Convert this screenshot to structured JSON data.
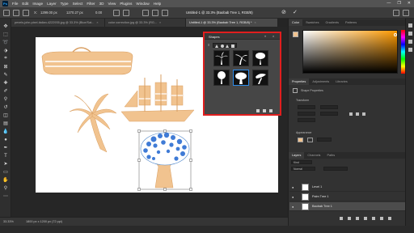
{
  "menubar": {
    "app_icon": "Ps",
    "items": [
      "File",
      "Edit",
      "Image",
      "Layer",
      "Type",
      "Select",
      "Filter",
      "3D",
      "View",
      "Plugins",
      "Window",
      "Help"
    ],
    "window_controls": [
      "—",
      "❐",
      "✕"
    ]
  },
  "options": {
    "w_value": "1299.00 px",
    "h_value": "1270.27 px",
    "angle_value": "0.00",
    "doc_status": "Untitled-1 @ 33.3% (Baobab Tree 1, RGB/8)",
    "cancel_icon": "⊘",
    "commit_icon": "✓"
  },
  "tabs": [
    {
      "label": "pexels-john-pixel-italian-4222935.jpg @ 33.3% (Blue/Sat...",
      "close": "×"
    },
    {
      "label": "color correction.jpg @ 33.3% (RG...",
      "close": "×"
    },
    {
      "label": "Untitled-1 @ 33.3% (Baobab Tree 1, RGB/8) *",
      "close": "×"
    }
  ],
  "shapes_panel": {
    "title": "Shapes",
    "collapse": "«",
    "close": "×",
    "menu": "≡"
  },
  "right_panels": {
    "color_tabs": [
      "Color",
      "Swatches",
      "Gradients",
      "Patterns"
    ],
    "props_tabs": [
      "Properties",
      "Adjustments",
      "Libraries"
    ],
    "shape_properties_label": "Shape Properties",
    "transform_label": "Transform",
    "appearance_label": "Appearance",
    "layers_tabs": [
      "Layers",
      "Channels",
      "Paths"
    ],
    "layer_filter_kind": "Kind",
    "layer_blend": "Normal",
    "layers": [
      {
        "name": "Level 1",
        "selected": false
      },
      {
        "name": "Palm Tree 1",
        "selected": false
      },
      {
        "name": "Baobab Tree 1",
        "selected": true
      }
    ]
  },
  "status": {
    "zoom": "33.33%",
    "doc_size": "1800 px x 1200 px (72 ppi)"
  },
  "colors": {
    "highlight": "#e01e1e",
    "shape_fill": "#f1c38f",
    "selection": "#2d8ceb"
  }
}
